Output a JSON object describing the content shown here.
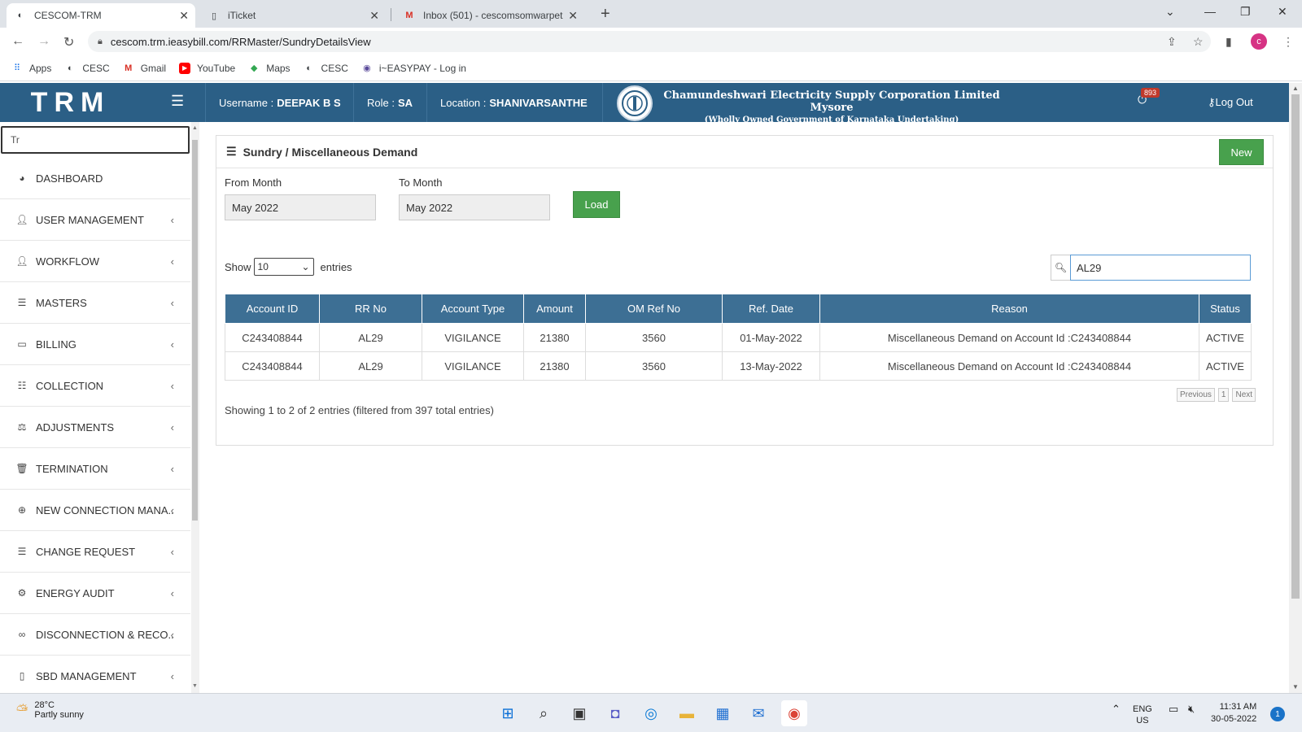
{
  "browser": {
    "tabs": [
      {
        "title": "CESCOM-TRM",
        "active": true
      },
      {
        "title": "iTicket",
        "active": false
      },
      {
        "title": "Inbox (501) - cescomsomwarpet",
        "active": false
      }
    ],
    "url": "cescom.trm.ieasybill.com/RRMaster/SundryDetailsView",
    "profile_initial": "c",
    "bookmarks": [
      "Apps",
      "CESC",
      "Gmail",
      "YouTube",
      "Maps",
      "CESC",
      "i~EASYPAY - Log in"
    ]
  },
  "header": {
    "brand": "TRM",
    "username_label": "Username :",
    "username": "DEEPAK B S",
    "role_label": "Role :",
    "role": "SA",
    "location_label": "Location :",
    "location": "SHANIVARSANTHE",
    "corp_name": "Chamundeshwari Electricity Supply Corporation Limited Mysore",
    "corp_sub": "(Wholly Owned Government of Karnataka Undertaking)",
    "notification_count": "893",
    "logout": "Log Out"
  },
  "sidebar": {
    "search_value": "Tr",
    "items": [
      {
        "label": "DASHBOARD",
        "icon": "dashboard-icon",
        "has_children": false
      },
      {
        "label": "USER MANAGEMENT",
        "icon": "user-icon",
        "has_children": true
      },
      {
        "label": "WORKFLOW",
        "icon": "user-icon",
        "has_children": true
      },
      {
        "label": "MASTERS",
        "icon": "list-icon",
        "has_children": true
      },
      {
        "label": "BILLING",
        "icon": "monitor-icon",
        "has_children": true
      },
      {
        "label": "COLLECTION",
        "icon": "list-numbered-icon",
        "has_children": true
      },
      {
        "label": "ADJUSTMENTS",
        "icon": "scale-icon",
        "has_children": true
      },
      {
        "label": "TERMINATION",
        "icon": "trash-icon",
        "has_children": true
      },
      {
        "label": "NEW CONNECTION MANA..",
        "icon": "plus-circle-icon",
        "has_children": true
      },
      {
        "label": "CHANGE REQUEST",
        "icon": "list-icon",
        "has_children": true
      },
      {
        "label": "ENERGY AUDIT",
        "icon": "gears-icon",
        "has_children": true
      },
      {
        "label": "DISCONNECTION & RECO..",
        "icon": "link-icon",
        "has_children": true
      },
      {
        "label": "SBD MANAGEMENT",
        "icon": "mobile-icon",
        "has_children": true
      }
    ]
  },
  "page": {
    "title": "Sundry / Miscellaneous Demand",
    "new_button": "New",
    "from_month_label": "From Month",
    "from_month_value": "May 2022",
    "to_month_label": "To Month",
    "to_month_value": "May 2022",
    "load_button": "Load",
    "show_label": "Show",
    "entries_label": "entries",
    "page_size": "10",
    "search_value": "AL29",
    "columns": [
      "Account ID",
      "RR No",
      "Account Type",
      "Amount",
      "OM Ref No",
      "Ref. Date",
      "Reason",
      "Status"
    ],
    "rows": [
      [
        "C243408844",
        "AL29",
        "VIGILANCE",
        "21380",
        "3560",
        "01-May-2022",
        "Miscellaneous Demand on Account Id :C243408844",
        "ACTIVE"
      ],
      [
        "C243408844",
        "AL29",
        "VIGILANCE",
        "21380",
        "3560",
        "13-May-2022",
        "Miscellaneous Demand on Account Id :C243408844",
        "ACTIVE"
      ]
    ],
    "info": "Showing 1 to 2 of 2 entries (filtered from 397 total entries)",
    "pager": {
      "previous": "Previous",
      "page": "1",
      "next": "Next"
    }
  },
  "taskbar": {
    "temperature": "28°C",
    "weather": "Partly sunny",
    "lang": "ENG",
    "region": "US",
    "time": "11:31 AM",
    "date": "30-05-2022",
    "notifications": "1"
  }
}
